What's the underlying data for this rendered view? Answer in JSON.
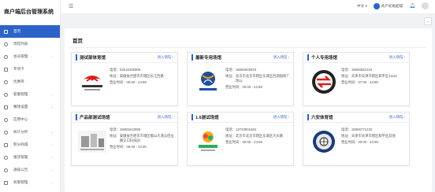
{
  "app": {
    "title": "商户端后台管理系统"
  },
  "sidebar": {
    "items": [
      {
        "label": "首页",
        "active": true,
        "icon": "home-icon",
        "has_children": false
      },
      {
        "label": "场馆列表",
        "icon": "list-icon",
        "has_children": false
      },
      {
        "label": "会员管理",
        "icon": "member-icon",
        "has_children": true
      },
      {
        "label": "专项卡",
        "icon": "card-icon",
        "has_children": false
      },
      {
        "label": "优惠券",
        "icon": "coupon-icon",
        "has_children": false
      },
      {
        "label": "套餐管理",
        "icon": "package-icon",
        "has_children": true
      },
      {
        "label": "赛场设置",
        "icon": "settings-icon",
        "has_children": true
      },
      {
        "label": "应用中心",
        "icon": "app-icon",
        "has_children": false
      },
      {
        "label": "统计分析",
        "icon": "stats-icon",
        "has_children": true
      },
      {
        "label": "积分商城",
        "icon": "mall-icon",
        "has_children": true
      },
      {
        "label": "报货管理",
        "icon": "goods-icon",
        "has_children": true
      },
      {
        "label": "通知公告",
        "icon": "notice-icon",
        "has_children": true
      },
      {
        "label": "权限管理",
        "icon": "lock-icon",
        "has_children": true
      }
    ]
  },
  "topbar": {
    "language": "中文",
    "user": "商户初始超级",
    "fold_icon": "menu-fold-icon",
    "bell_icon": "bell-icon",
    "user_icon": "user-icon"
  },
  "main": {
    "title": "首页"
  },
  "labels": {
    "phone": "电话：",
    "address": "地址：",
    "hours": "营业时间：",
    "enter": "进入场馆 ›"
  },
  "cards": [
    {
      "name": "测试部体育馆",
      "phone": "03516436908",
      "address": "安徽省合肥市市辖区长江西路",
      "hours": "00:00 - 23:59",
      "logo": "china-team-logo"
    },
    {
      "name": "最新专用场馆",
      "phone": "18665625023",
      "address": "北京市北京市辖区东城区西湖国际广场11",
      "hours": "00:00 - 22:59",
      "logo": "eurocup-logo"
    },
    {
      "name": "个人专用场馆",
      "phone": "18655661234",
      "address": "天津市天津市辖区和平区11111",
      "hours": "07:00 - 23:59",
      "logo": "red-arrows-logo"
    },
    {
      "name": "产品部测试场馆",
      "phone": "18655243999",
      "address": "安徽省合肥市市辖区蜀山大道与创业路交口科技园",
      "hours": "08:00 - 22:30",
      "logo": "sketch-building-logo"
    },
    {
      "name": "1.6测试场馆",
      "phone": "13733001684",
      "address": "北京市北京市辖区东城区大庆路",
      "hours": "00:00 - 23:59",
      "logo": "asian-games-logo"
    },
    {
      "name": "六安体育馆",
      "phone": "18665771233",
      "address": "天津市天津市辖区和平区其他",
      "hours": "00:00 - 23:59",
      "logo": "football-club-logo"
    }
  ],
  "colors": {
    "accent": "#2d62c9",
    "sidebar_bg": "#ffffff",
    "page_bg": "#f0f2f5"
  }
}
